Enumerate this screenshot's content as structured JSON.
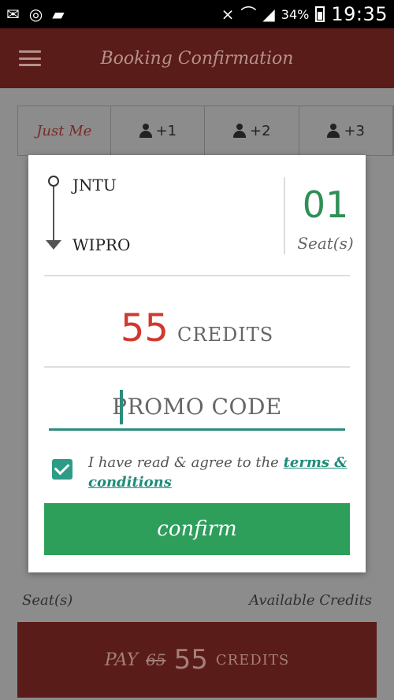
{
  "statusbar": {
    "battery_pct": "34%",
    "time": "19:35"
  },
  "toolbar": {
    "title": "Booking Confirmation"
  },
  "seat_selector": {
    "options": [
      "Just Me",
      "+1",
      "+2",
      "+3"
    ]
  },
  "background": {
    "seats_label": "Seat(s)",
    "available_label": "Available Credits",
    "pay": {
      "label": "PAY",
      "old_amount": "65",
      "amount": "55",
      "unit": "CREDITS"
    }
  },
  "dialog": {
    "from": "JNTU",
    "to": "WIPRO",
    "seats_count": "01",
    "seats_label": "Seat(s)",
    "credits_amount": "55",
    "credits_unit": "CREDITS",
    "promo_placeholder": "PROMO CODE",
    "agree_text": "I have read & agree to the ",
    "terms_link": "terms & conditions",
    "agree_checked": true,
    "confirm_label": "confirm"
  },
  "colors": {
    "toolbar": "#5a1c18",
    "accent_green": "#2e9e5b",
    "teal": "#2d8c7b",
    "credits_red": "#d0392f"
  }
}
